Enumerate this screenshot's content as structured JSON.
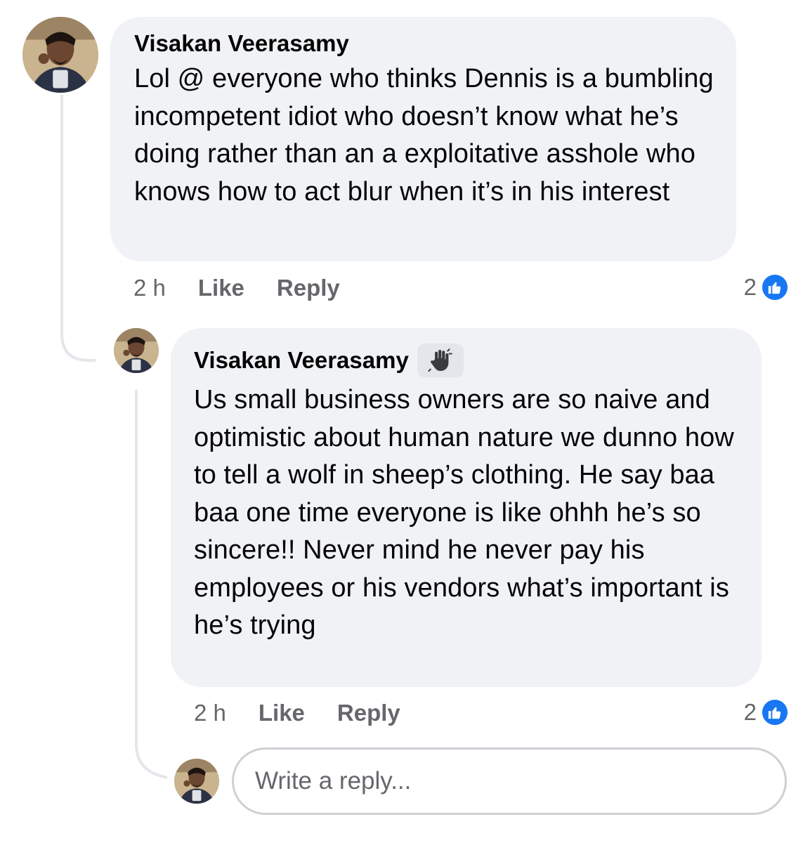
{
  "comments": [
    {
      "author": "Visakan Veerasamy",
      "text": "Lol @ everyone who thinks Dennis is a bumbling incompetent idiot who doesn’t know what he’s doing rather than an a exploitative asshole who knows how to act blur when it’s in his interest",
      "time": "2 h",
      "like_label": "Like",
      "reply_label": "Reply",
      "reaction_count": "2",
      "reaction_icon": "thumbs-up-icon"
    },
    {
      "author": "Visakan Veerasamy",
      "badge_icon": "waving-hand-icon",
      "text": "Us small business owners are so naive and optimistic about human nature we dunno how to tell a wolf in sheep’s clothing. He say baa baa one time everyone is like ohhh he’s so sincere!! Never mind he never pay his employees or his vendors what’s important is he’s trying",
      "time": "2 h",
      "like_label": "Like",
      "reply_label": "Reply",
      "reaction_count": "2",
      "reaction_icon": "thumbs-up-icon"
    }
  ],
  "reply_input": {
    "placeholder": "Write a reply..."
  },
  "colors": {
    "bubble": "#f0f2f5",
    "like_blue": "#1877f2",
    "muted": "#65676b"
  }
}
